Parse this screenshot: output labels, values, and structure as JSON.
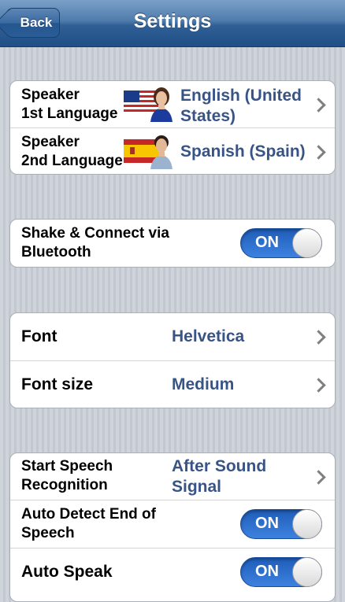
{
  "nav": {
    "back": "Back",
    "title": "Settings"
  },
  "languages": {
    "first": {
      "label_line1": "Speaker",
      "label_line2": "1st Language",
      "value_line1": "English (United",
      "value_line2": "States)"
    },
    "second": {
      "label_line1": "Speaker",
      "label_line2": "2nd Language",
      "value": "Spanish (Spain)"
    }
  },
  "bluetooth": {
    "label_line1": "Shake & Connect via",
    "label_line2": "Bluetooth",
    "toggle": "ON"
  },
  "font": {
    "font_label": "Font",
    "font_value": "Helvetica",
    "size_label": "Font size",
    "size_value": "Medium"
  },
  "speech": {
    "start": {
      "label_line1": "Start Speech",
      "label_line2": "Recognition",
      "value_line1": "After Sound",
      "value_line2": "Signal"
    },
    "auto_detect": {
      "label_line1": "Auto Detect End of",
      "label_line2": "Speech",
      "toggle": "ON"
    },
    "auto_speak": {
      "label": "Auto Speak",
      "toggle": "ON"
    }
  },
  "icons": [
    "back-arrow",
    "us-flag-icon",
    "spain-flag-icon",
    "female-avatar-icon",
    "male-avatar-icon",
    "chevron-right-icon"
  ],
  "colors": {
    "navbar": "#2f5f94",
    "value_text": "#385487",
    "toggle_on": "#3d82e0"
  }
}
